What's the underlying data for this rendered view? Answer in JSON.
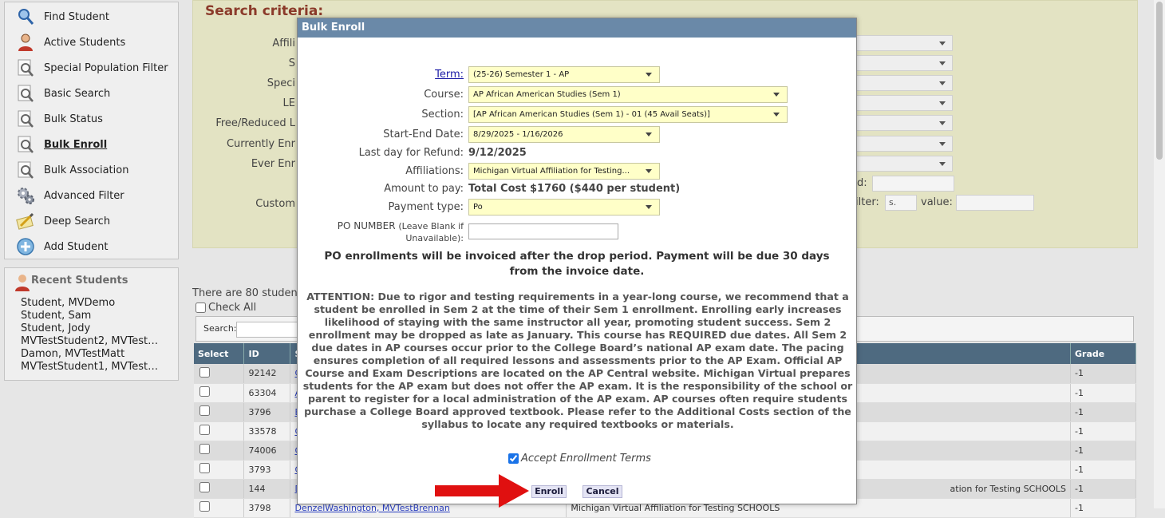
{
  "sidebar": {
    "items": [
      {
        "label": "Find Student",
        "icon": "magnifier-icon"
      },
      {
        "label": "Active Students",
        "icon": "person-icon"
      },
      {
        "label": "Special Population Filter",
        "icon": "document-search-icon"
      },
      {
        "label": "Basic Search",
        "icon": "document-search-icon"
      },
      {
        "label": "Bulk Status",
        "icon": "document-search-icon"
      },
      {
        "label": "Bulk Enroll",
        "icon": "document-search-icon"
      },
      {
        "label": "Bulk Association",
        "icon": "document-search-icon"
      },
      {
        "label": "Advanced Filter",
        "icon": "gears-icon"
      },
      {
        "label": "Deep Search",
        "icon": "pencil-paper-icon"
      },
      {
        "label": "Add Student",
        "icon": "add-globe-icon"
      }
    ],
    "recent_title": "Recent Students",
    "recent": [
      "Student, MVDemo",
      "Student, Sam",
      "Student, Jody",
      "MVTestStudent2, MVTest…",
      "Damon, MVTestMatt",
      "MVTestStudent1, MVTest…"
    ]
  },
  "criteria": {
    "title": "Search criteria:",
    "labels": [
      "Affili",
      "S",
      "Speci",
      "LE",
      "Free/Reduced L",
      "Currently Enr",
      "Ever Enr",
      "Custom"
    ],
    "field_label_d": "d:",
    "filter_label": "ilter:",
    "filter_value": "s.",
    "value_label": "value:"
  },
  "results": {
    "count_text": "There are 80 studen",
    "check_all": "Check All",
    "search_label": "Search:",
    "columns": {
      "select": "Select",
      "id": "ID",
      "s": "S",
      "grade": "Grade"
    },
    "rows": [
      {
        "id": "92142",
        "name": "C",
        "aff": "",
        "grade": "-1"
      },
      {
        "id": "63304",
        "name": "A",
        "aff": "",
        "grade": "-1"
      },
      {
        "id": "3796",
        "name": "E",
        "aff": "",
        "grade": "-1"
      },
      {
        "id": "33578",
        "name": "C",
        "aff": "",
        "grade": "-1"
      },
      {
        "id": "74006",
        "name": "C",
        "aff": "",
        "grade": "-1"
      },
      {
        "id": "3793",
        "name": "C",
        "aff": "",
        "grade": "-1"
      },
      {
        "id": "144",
        "name": "D",
        "aff": "ation for Testing SCHOOLS",
        "grade": "-1"
      },
      {
        "id": "3798",
        "name": "DenzelWashington, MVTestBrennan",
        "aff": "Michigan Virtual Affiliation for Testing SCHOOLS",
        "grade": "-1"
      }
    ]
  },
  "modal": {
    "title": "Bulk Enroll",
    "term_label": "Term:",
    "term_value": "(25-26) Semester 1 - AP",
    "course_label": "Course:",
    "course_value": "AP African American Studies (Sem 1)",
    "section_label": "Section:",
    "section_value": "[AP African American Studies (Sem 1) - 01 (45 Avail Seats)]",
    "dates_label": "Start-End Date:",
    "dates_value": "8/29/2025 - 1/16/2026",
    "refund_label": "Last day for Refund:",
    "refund_value": "9/12/2025",
    "aff_label": "Affiliations:",
    "aff_value": "Michigan Virtual Affiliation for Testing...",
    "amount_label": "Amount to pay:",
    "amount_value": "Total Cost $1760 ($440 per student)",
    "paytype_label": "Payment type:",
    "paytype_value": "Po",
    "po_label": "PO NUMBER",
    "po_hint": "(Leave Blank if Unavailable):",
    "po_value": "",
    "notice": "PO enrollments will be invoiced after the drop period. Payment will be due 30 days from the invoice date.",
    "attention": "ATTENTION: Due to rigor and testing requirements in a year-long course, we recommend that a student be enrolled in Sem 2 at the time of their Sem 1 enrollment. Enrolling early increases likelihood of staying with the same instructor all year, promoting student success. Sem 2 enrollment may be dropped as late as January. This course has REQUIRED due dates. All Sem 2 due dates in AP courses occur prior to the College Board’s national AP exam date. The pacing ensures completion of all required lessons and assessments prior to the AP Exam. Official AP Course and Exam Descriptions are located on the AP Central website. Michigan Virtual prepares students for the AP exam but does not offer the AP exam. It is the responsibility of the school or parent to register for a local administration of the AP exam. AP courses often require students purchase a College Board approved textbook. Please refer to the Additional Costs section of the syllabus to locate any required textbooks or materials.",
    "accept_label": "Accept Enrollment Terms",
    "enroll_label": "Enroll",
    "cancel_label": "Cancel"
  },
  "colors": {
    "modal_header": "#6a89a8",
    "grid_header": "#4e6a80",
    "field_bg": "#ffffc8",
    "criteria_bg": "#e3e3c3",
    "arrow": "#e01010"
  }
}
